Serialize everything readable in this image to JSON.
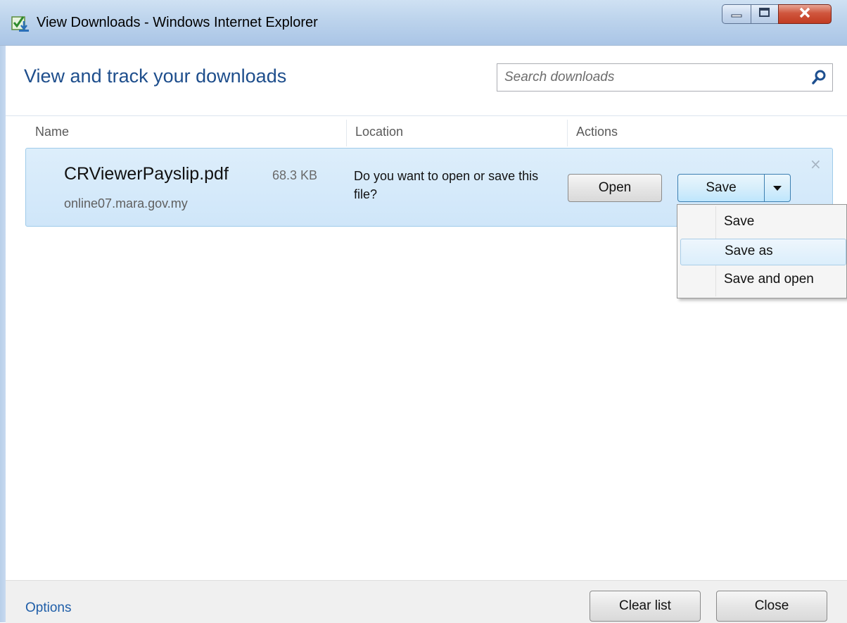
{
  "window": {
    "title": "View Downloads - Windows Internet Explorer"
  },
  "header": {
    "title": "View and track your downloads",
    "search_placeholder": "Search downloads"
  },
  "columns": {
    "name": "Name",
    "location": "Location",
    "actions": "Actions"
  },
  "download": {
    "file_name": "CRViewerPayslip.pdf",
    "file_size": "68.3 KB",
    "source": "online07.mara.gov.my",
    "status": "Do you want to open or save this file?",
    "open_label": "Open",
    "save_label": "Save",
    "dismiss_glyph": "×"
  },
  "save_menu": {
    "items": [
      {
        "label": "Save"
      },
      {
        "label": "Save as"
      },
      {
        "label": "Save and open"
      }
    ],
    "highlighted": "Save as"
  },
  "footer": {
    "options_label": "Options",
    "clear_label": "Clear list",
    "close_label": "Close"
  }
}
